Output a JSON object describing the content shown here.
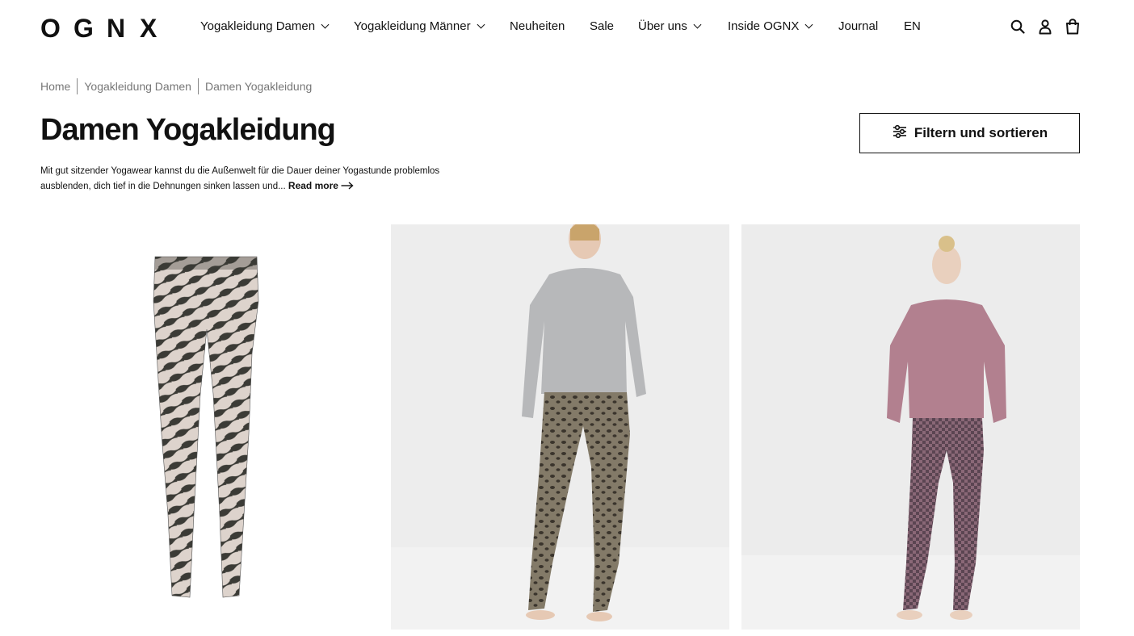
{
  "header": {
    "logo_letters": [
      "O",
      "G",
      "N",
      "X"
    ],
    "nav": [
      {
        "label": "Yogakleidung Damen",
        "has_dropdown": true
      },
      {
        "label": "Yogakleidung Männer",
        "has_dropdown": true
      },
      {
        "label": "Neuheiten",
        "has_dropdown": false
      },
      {
        "label": "Sale",
        "has_dropdown": false
      },
      {
        "label": "Über uns",
        "has_dropdown": true
      },
      {
        "label": "Inside OGNX",
        "has_dropdown": true
      },
      {
        "label": "Journal",
        "has_dropdown": false
      },
      {
        "label": "EN",
        "has_dropdown": false
      }
    ],
    "icons": [
      "search-icon",
      "account-icon",
      "cart-icon"
    ]
  },
  "breadcrumb": [
    "Home",
    "Yogakleidung Damen",
    "Damen Yogakleidung"
  ],
  "page": {
    "title": "Damen Yogakleidung",
    "filter_label": "Filtern und sortieren",
    "description": "Mit gut sitzender Yogawear kannst du die Außenwelt für die Dauer deiner Yogastunde problemlos ausblenden, dich tief in die Dehnungen sinken lassen und...",
    "read_more": "Read more"
  },
  "products": [
    {
      "image": "zebra-print-leggings"
    },
    {
      "image": "model-grey-top-leopard-leggings"
    },
    {
      "image": "model-pink-sweatshirt-patterned-leggings"
    }
  ],
  "colors": {
    "text": "#111111",
    "muted": "#777777",
    "card_bg": "#ededed"
  }
}
